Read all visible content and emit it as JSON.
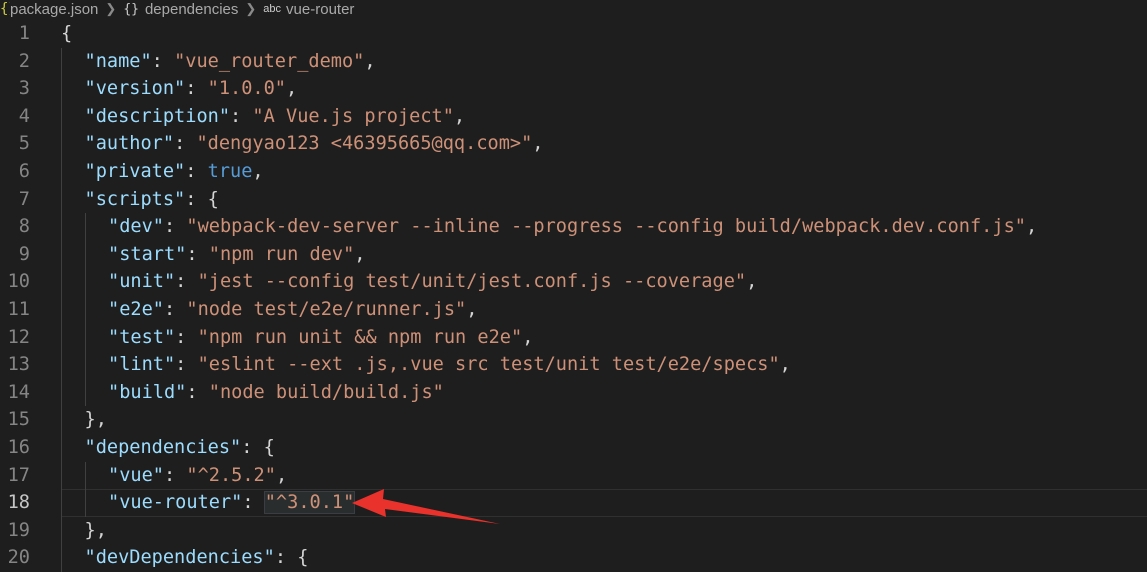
{
  "breadcrumb": {
    "items": [
      {
        "label": "package.json",
        "icon": "json-file-icon"
      },
      {
        "label": "dependencies",
        "icon": "braces-icon",
        "icon_glyph": "{}"
      },
      {
        "label": "vue-router",
        "icon": "string-abc-icon",
        "icon_glyph": "abc"
      }
    ]
  },
  "editor": {
    "active_line": 18,
    "lines": [
      {
        "n": "1",
        "tokens": [
          {
            "t": "{",
            "c": "brace"
          }
        ]
      },
      {
        "n": "2",
        "tokens": [
          {
            "t": "\"name\"",
            "c": "key"
          },
          {
            "t": ": ",
            "c": "punct"
          },
          {
            "t": "\"vue_router_demo\"",
            "c": "str"
          },
          {
            "t": ",",
            "c": "punct"
          }
        ]
      },
      {
        "n": "3",
        "tokens": [
          {
            "t": "\"version\"",
            "c": "key"
          },
          {
            "t": ": ",
            "c": "punct"
          },
          {
            "t": "\"1.0.0\"",
            "c": "str"
          },
          {
            "t": ",",
            "c": "punct"
          }
        ]
      },
      {
        "n": "4",
        "tokens": [
          {
            "t": "\"description\"",
            "c": "key"
          },
          {
            "t": ": ",
            "c": "punct"
          },
          {
            "t": "\"A Vue.js project\"",
            "c": "str"
          },
          {
            "t": ",",
            "c": "punct"
          }
        ]
      },
      {
        "n": "5",
        "tokens": [
          {
            "t": "\"author\"",
            "c": "key"
          },
          {
            "t": ": ",
            "c": "punct"
          },
          {
            "t": "\"dengyao123 <46395665@qq.com>\"",
            "c": "str"
          },
          {
            "t": ",",
            "c": "punct"
          }
        ]
      },
      {
        "n": "6",
        "tokens": [
          {
            "t": "\"private\"",
            "c": "key"
          },
          {
            "t": ": ",
            "c": "punct"
          },
          {
            "t": "true",
            "c": "bool"
          },
          {
            "t": ",",
            "c": "punct"
          }
        ]
      },
      {
        "n": "7",
        "tokens": [
          {
            "t": "\"scripts\"",
            "c": "key"
          },
          {
            "t": ": ",
            "c": "punct"
          },
          {
            "t": "{",
            "c": "brace"
          }
        ]
      },
      {
        "n": "8",
        "tokens": [
          {
            "t": "\"dev\"",
            "c": "key"
          },
          {
            "t": ": ",
            "c": "punct"
          },
          {
            "t": "\"webpack-dev-server --inline --progress --config build/webpack.dev.conf.js\"",
            "c": "str"
          },
          {
            "t": ",",
            "c": "punct"
          }
        ]
      },
      {
        "n": "9",
        "tokens": [
          {
            "t": "\"start\"",
            "c": "key"
          },
          {
            "t": ": ",
            "c": "punct"
          },
          {
            "t": "\"npm run dev\"",
            "c": "str"
          },
          {
            "t": ",",
            "c": "punct"
          }
        ]
      },
      {
        "n": "10",
        "tokens": [
          {
            "t": "\"unit\"",
            "c": "key"
          },
          {
            "t": ": ",
            "c": "punct"
          },
          {
            "t": "\"jest --config test/unit/jest.conf.js --coverage\"",
            "c": "str"
          },
          {
            "t": ",",
            "c": "punct"
          }
        ]
      },
      {
        "n": "11",
        "tokens": [
          {
            "t": "\"e2e\"",
            "c": "key"
          },
          {
            "t": ": ",
            "c": "punct"
          },
          {
            "t": "\"node test/e2e/runner.js\"",
            "c": "str"
          },
          {
            "t": ",",
            "c": "punct"
          }
        ]
      },
      {
        "n": "12",
        "tokens": [
          {
            "t": "\"test\"",
            "c": "key"
          },
          {
            "t": ": ",
            "c": "punct"
          },
          {
            "t": "\"npm run unit && npm run e2e\"",
            "c": "str"
          },
          {
            "t": ",",
            "c": "punct"
          }
        ]
      },
      {
        "n": "13",
        "tokens": [
          {
            "t": "\"lint\"",
            "c": "key"
          },
          {
            "t": ": ",
            "c": "punct"
          },
          {
            "t": "\"eslint --ext .js,.vue src test/unit test/e2e/specs\"",
            "c": "str"
          },
          {
            "t": ",",
            "c": "punct"
          }
        ]
      },
      {
        "n": "14",
        "tokens": [
          {
            "t": "\"build\"",
            "c": "key"
          },
          {
            "t": ": ",
            "c": "punct"
          },
          {
            "t": "\"node build/build.js\"",
            "c": "str"
          }
        ]
      },
      {
        "n": "15",
        "tokens": [
          {
            "t": "},",
            "c": "brace"
          }
        ]
      },
      {
        "n": "16",
        "tokens": [
          {
            "t": "\"dependencies\"",
            "c": "key"
          },
          {
            "t": ": ",
            "c": "punct"
          },
          {
            "t": "{",
            "c": "brace"
          }
        ]
      },
      {
        "n": "17",
        "tokens": [
          {
            "t": "\"vue\"",
            "c": "key"
          },
          {
            "t": ": ",
            "c": "punct"
          },
          {
            "t": "\"^2.5.2\"",
            "c": "str"
          },
          {
            "t": ",",
            "c": "punct"
          }
        ]
      },
      {
        "n": "18",
        "tokens": [
          {
            "t": "\"vue-router\"",
            "c": "key"
          },
          {
            "t": ": ",
            "c": "punct"
          },
          {
            "t": "\"^3.0.1\"",
            "c": "str",
            "highlight": true
          }
        ]
      },
      {
        "n": "19",
        "tokens": [
          {
            "t": "},",
            "c": "brace"
          }
        ]
      },
      {
        "n": "20",
        "tokens": [
          {
            "t": "\"devDependencies\"",
            "c": "key"
          },
          {
            "t": ": ",
            "c": "punct"
          },
          {
            "t": "{",
            "c": "brace"
          }
        ]
      }
    ]
  },
  "colors": {
    "background": "#1e1e1e",
    "key": "#9cdcfe",
    "string": "#ce9178",
    "keyword": "#569cd6",
    "punctuation": "#d4d4d4",
    "line_number": "#858585",
    "annotation_arrow": "#e8322b"
  },
  "annotation": {
    "icon": "red-arrow-icon"
  }
}
